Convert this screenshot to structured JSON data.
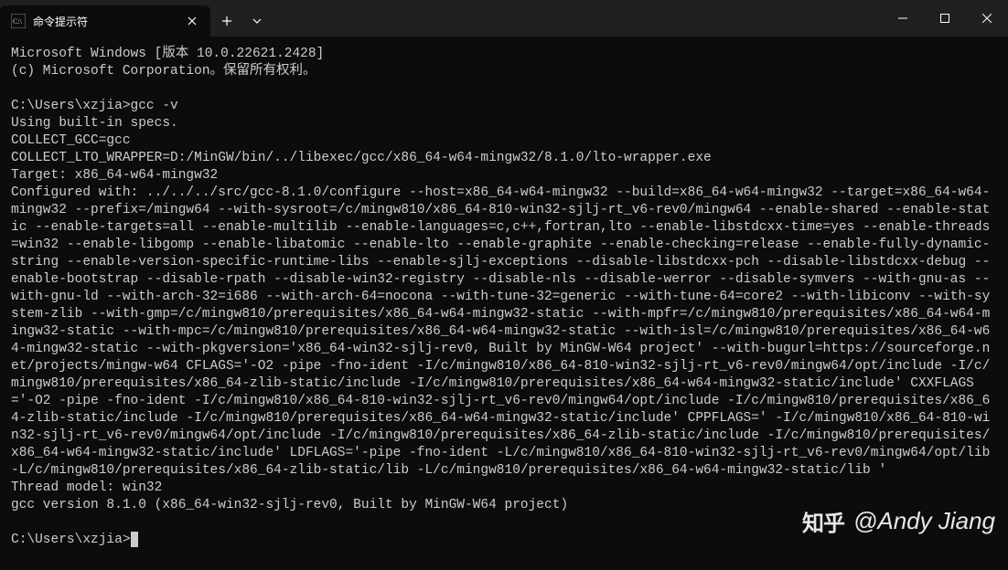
{
  "window": {
    "tab_title": "命令提示符",
    "tab_icon": "cmd-icon"
  },
  "terminal": {
    "header1": "Microsoft Windows [版本 10.0.22621.2428]",
    "header2": "(c) Microsoft Corporation。保留所有权利。",
    "prompt1": "C:\\Users\\xzjia>",
    "command1": "gcc -v",
    "line1": "Using built-in specs.",
    "line2": "COLLECT_GCC=gcc",
    "line3": "COLLECT_LTO_WRAPPER=D:/MinGW/bin/../libexec/gcc/x86_64-w64-mingw32/8.1.0/lto-wrapper.exe",
    "line4": "Target: x86_64-w64-mingw32",
    "configured": "Configured with: ../../../src/gcc-8.1.0/configure --host=x86_64-w64-mingw32 --build=x86_64-w64-mingw32 --target=x86_64-w64-mingw32 --prefix=/mingw64 --with-sysroot=/c/mingw810/x86_64-810-win32-sjlj-rt_v6-rev0/mingw64 --enable-shared --enable-static --enable-targets=all --enable-multilib --enable-languages=c,c++,fortran,lto --enable-libstdcxx-time=yes --enable-threads=win32 --enable-libgomp --enable-libatomic --enable-lto --enable-graphite --enable-checking=release --enable-fully-dynamic-string --enable-version-specific-runtime-libs --enable-sjlj-exceptions --disable-libstdcxx-pch --disable-libstdcxx-debug --enable-bootstrap --disable-rpath --disable-win32-registry --disable-nls --disable-werror --disable-symvers --with-gnu-as --with-gnu-ld --with-arch-32=i686 --with-arch-64=nocona --with-tune-32=generic --with-tune-64=core2 --with-libiconv --with-system-zlib --with-gmp=/c/mingw810/prerequisites/x86_64-w64-mingw32-static --with-mpfr=/c/mingw810/prerequisites/x86_64-w64-mingw32-static --with-mpc=/c/mingw810/prerequisites/x86_64-w64-mingw32-static --with-isl=/c/mingw810/prerequisites/x86_64-w64-mingw32-static --with-pkgversion='x86_64-win32-sjlj-rev0, Built by MinGW-W64 project' --with-bugurl=https://sourceforge.net/projects/mingw-w64 CFLAGS='-O2 -pipe -fno-ident -I/c/mingw810/x86_64-810-win32-sjlj-rt_v6-rev0/mingw64/opt/include -I/c/mingw810/prerequisites/x86_64-zlib-static/include -I/c/mingw810/prerequisites/x86_64-w64-mingw32-static/include' CXXFLAGS='-O2 -pipe -fno-ident -I/c/mingw810/x86_64-810-win32-sjlj-rt_v6-rev0/mingw64/opt/include -I/c/mingw810/prerequisites/x86_64-zlib-static/include -I/c/mingw810/prerequisites/x86_64-w64-mingw32-static/include' CPPFLAGS=' -I/c/mingw810/x86_64-810-win32-sjlj-rt_v6-rev0/mingw64/opt/include -I/c/mingw810/prerequisites/x86_64-zlib-static/include -I/c/mingw810/prerequisites/x86_64-w64-mingw32-static/include' LDFLAGS='-pipe -fno-ident -L/c/mingw810/x86_64-810-win32-sjlj-rt_v6-rev0/mingw64/opt/lib -L/c/mingw810/prerequisites/x86_64-zlib-static/lib -L/c/mingw810/prerequisites/x86_64-w64-mingw32-static/lib '",
    "thread_model": "Thread model: win32",
    "version": "gcc version 8.1.0 (x86_64-win32-sjlj-rev0, Built by MinGW-W64 project)",
    "prompt2": "C:\\Users\\xzjia>"
  },
  "watermark": {
    "logo": "知乎",
    "author": "@Andy Jiang"
  }
}
